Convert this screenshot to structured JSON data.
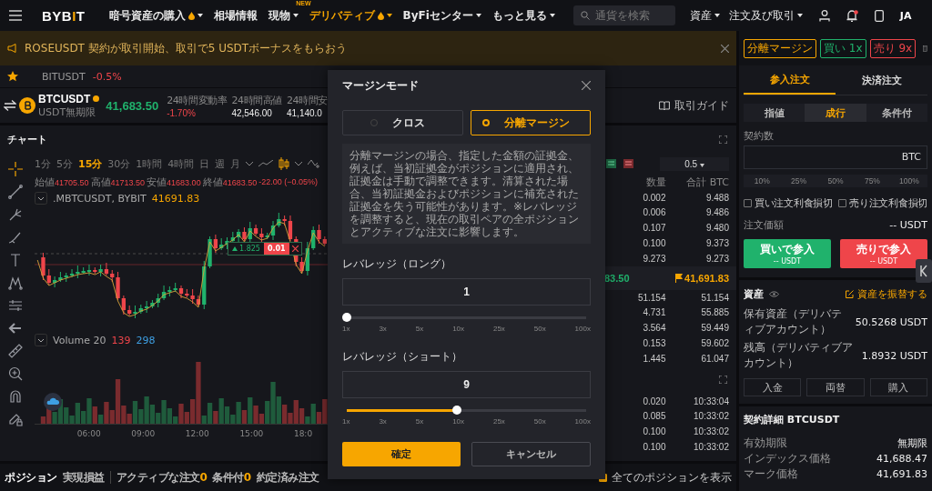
{
  "nav": {
    "logo": {
      "before": "BYB",
      "accent": "I",
      "after": "T"
    },
    "items": [
      {
        "label": "暗号資産の購入",
        "flame": true,
        "dropdown": true,
        "selected": false
      },
      {
        "label": "相場情報",
        "flame": false,
        "dropdown": false,
        "selected": false
      },
      {
        "label": "現物",
        "flame": false,
        "dropdown": true,
        "selected": false,
        "badge": "NEW"
      },
      {
        "label": "デリバティブ",
        "flame": true,
        "dropdown": true,
        "selected": true
      },
      {
        "label": "ByFiセンター",
        "flame": false,
        "dropdown": true,
        "selected": false
      },
      {
        "label": "もっと見る",
        "flame": false,
        "dropdown": true,
        "selected": false
      }
    ],
    "search": {
      "placeholder": "通貨を検索"
    },
    "right_items": [
      {
        "label": "資産",
        "dropdown": true
      },
      {
        "label": "注文及び取引",
        "dropdown": true
      }
    ],
    "notification_dot": true,
    "language": "JA"
  },
  "banner": {
    "text": "ROSEUSDT 契約が取引開始、取引で5 USDTボーナスをもらおう"
  },
  "ticker": {
    "symbol": "BITUSDT",
    "change": "-0.5%"
  },
  "symbol_header": {
    "symbol": "BTCUSDT",
    "subtitle": "USDT無期限",
    "price": "41,683.50",
    "stats": [
      {
        "label": "24時間変動率",
        "value": "-1.70%",
        "negative": true
      },
      {
        "label": "24時間高値",
        "value": "42,546.00",
        "negative": false
      },
      {
        "label": "24時間安",
        "value": "41,140.0",
        "negative": false
      }
    ],
    "guide": "取引ガイド"
  },
  "chart": {
    "title": "チャート",
    "intervals": [
      {
        "label": "1分",
        "selected": false
      },
      {
        "label": "5分",
        "selected": false
      },
      {
        "label": "15分",
        "selected": true
      },
      {
        "label": "30分",
        "selected": false
      },
      {
        "label": "1時間",
        "selected": false
      },
      {
        "label": "4時間",
        "selected": false
      },
      {
        "label": "日",
        "selected": false
      },
      {
        "label": "週",
        "selected": false
      },
      {
        "label": "月",
        "selected": false
      }
    ],
    "chart_types": [
      {
        "kind": "line",
        "selected": false
      },
      {
        "kind": "candle",
        "selected": true
      }
    ],
    "tools": [
      {
        "kind": "crosshair",
        "selected": true
      },
      {
        "kind": "trend-line",
        "selected": false
      },
      {
        "kind": "fork",
        "selected": false
      },
      {
        "kind": "brush",
        "selected": false
      },
      {
        "kind": "text",
        "selected": false
      },
      {
        "kind": "pattern",
        "selected": false
      },
      {
        "kind": "measure",
        "selected": false
      },
      {
        "kind": "arrow",
        "selected": false
      },
      {
        "kind": "ruler",
        "selected": false
      },
      {
        "kind": "zoom",
        "selected": false
      },
      {
        "kind": "magnet",
        "selected": false
      },
      {
        "kind": "lock",
        "selected": false
      }
    ],
    "ohlc": [
      {
        "label": "始値",
        "value": "41705.50"
      },
      {
        "label": "高値",
        "value": "41713.50"
      },
      {
        "label": "安値",
        "value": "41683.00"
      },
      {
        "label": "終値",
        "value": "41683.50"
      }
    ],
    "ohlc_change": "-22.00 (−0.05%)",
    "legend": {
      "name": ".MBTCUSDT, BYBIT",
      "value": "41691.83"
    },
    "order_tag": {
      "size": "1.825",
      "qty": "0.01"
    },
    "volume": {
      "name": "Volume 20",
      "value_1": "139",
      "value_2": "298"
    },
    "time_ticks": [
      "06:00",
      "09:00",
      "12:00",
      "15:00",
      "18:0"
    ]
  },
  "order_book": {
    "step": "0.5",
    "columns": [
      "数量",
      "合計 BTC"
    ],
    "asks": [
      [
        "0.002",
        "9.488"
      ],
      [
        "0.006",
        "9.486"
      ],
      [
        "0.107",
        "9.480"
      ],
      [
        "0.100",
        "9.373"
      ],
      [
        "9.273",
        "9.273"
      ]
    ],
    "last_price": "83.50",
    "mark_price": "41,691.83",
    "bids": [
      [
        "51.154",
        "51.154"
      ],
      [
        "4.731",
        "55.885"
      ],
      [
        "3.564",
        "59.449"
      ],
      [
        "0.153",
        "59.602"
      ],
      [
        "1.445",
        "61.047"
      ]
    ],
    "trades": [
      [
        "0.020",
        "10:33:04"
      ],
      [
        "0.085",
        "10:33:02"
      ],
      [
        "0.100",
        "10:33:02"
      ],
      [
        "0.100",
        "10:33:02"
      ]
    ]
  },
  "bottom_tabs": [
    {
      "label": "ポジション",
      "selected": true
    },
    {
      "label": "実現損益",
      "selected": false
    },
    {
      "label": "アクティブな注文",
      "count": "0",
      "selected": false
    },
    {
      "label": "条件付",
      "count": "0",
      "selected": false
    },
    {
      "label": "約定済み注文",
      "selected": false
    }
  ],
  "show_all_positions": {
    "label": "全てのポジションを表示",
    "checked": true
  },
  "modal": {
    "title": "マージンモード",
    "modes": [
      {
        "label": "クロス",
        "selected": false
      },
      {
        "label": "分離マージン",
        "selected": true
      }
    ],
    "description": "分離マージンの場合、指定した金額の証拠金、例えば、当初証拠金がポジションに適用され、証拠金は手動で調整できます。清算された場合、当初証拠金およびポジションに補充された証拠金を失う可能性があります。※レバレッジを調整すると、現在の取引ペアの全ポジションとアクティブな注文に影響します。",
    "leverages": [
      {
        "label": "レバレッジ（ロング）",
        "value": "1",
        "level": 0,
        "ticks": [
          "1x",
          "3x",
          "5x",
          "10x",
          "25x",
          "50x",
          "100x"
        ]
      },
      {
        "label": "レバレッジ（ショート）",
        "value": "9",
        "level": 0.46,
        "ticks": [
          "1x",
          "3x",
          "5x",
          "10x",
          "25x",
          "50x",
          "100x"
        ]
      }
    ],
    "confirm": "確定",
    "cancel": "キャンセル"
  },
  "trade_panel": {
    "tags": [
      {
        "label": "分離マージン",
        "color": "#f7a600"
      },
      {
        "label": "買い 1x",
        "color": "#20b26c"
      },
      {
        "label": "売り 9x",
        "color": "#ef454a"
      }
    ],
    "tabs": [
      {
        "label": "参入注文",
        "selected": true
      },
      {
        "label": "決済注文",
        "selected": false
      }
    ],
    "order_types": [
      {
        "label": "指値",
        "selected": false
      },
      {
        "label": "成行",
        "selected": true
      },
      {
        "label": "条件付",
        "selected": false
      }
    ],
    "qty_label": "契約数",
    "qty_unit": "BTC",
    "percents": [
      "10%",
      "25%",
      "50%",
      "75%",
      "100%"
    ],
    "tpsl": [
      {
        "label": "買い注文利食損切",
        "checked": false
      },
      {
        "label": "売り注文利食損切",
        "checked": false
      }
    ],
    "value_label": "注文価額",
    "value": "-- USDT",
    "buy": {
      "label": "買いで参入",
      "sub": "-- USDT"
    },
    "sell": {
      "label": "売りで参入",
      "sub": "-- USDT"
    },
    "assets_title": "資産",
    "transfer": "資産を振替する",
    "asset_rows": [
      {
        "label": "保有資産（デリバティブアカウント）",
        "value": "50.5268 USDT"
      },
      {
        "label": "残高（デリバティブアカウント）",
        "value": "1.8932 USDT"
      }
    ],
    "asset_buttons": [
      "入金",
      "両替",
      "購入"
    ],
    "contract_title": "契約詳細 BTCUSDT",
    "contract_rows": [
      {
        "label": "有効期限",
        "value": "無期限"
      },
      {
        "label": "インデックス価格",
        "value": "41,688.47"
      },
      {
        "label": "マーク価格",
        "value": "41,691.83"
      }
    ]
  }
}
